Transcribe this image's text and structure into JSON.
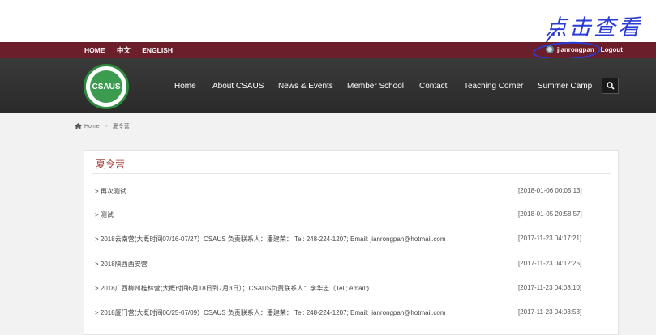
{
  "annotation": {
    "handwritten_note": "点击查看"
  },
  "topbar": {
    "links": [
      "HOME",
      "中文",
      "ENGLISH"
    ],
    "username": "jianrongpan",
    "logout": "Logout"
  },
  "logo_text": "CSAUS",
  "nav": {
    "items": [
      "Home",
      "About CSAUS",
      "News & Events",
      "Member School",
      "Contact",
      "Teaching Corner",
      "Summer Camp"
    ]
  },
  "breadcrumb": {
    "home": "Home",
    "current": "夏令营"
  },
  "card": {
    "title": "夏令营",
    "rows": [
      {
        "title": "> 再次测试",
        "date": "[2018-01-06 00:05:13]"
      },
      {
        "title": "> 测试",
        "date": "[2018-01-05 20:58:57]"
      },
      {
        "title": "> 2018云南营(大概时间07/16-07/27）CSAUS 负责联系人：潘建荣： Tel: 248-224-1207; Email: jianrongpan@hotmail.com",
        "date": "[2017-11-23 04:17:21]"
      },
      {
        "title": "> 2018陕西西安营",
        "date": "[2017-11-23 04:12:25]"
      },
      {
        "title": "> 2018广西柳州桂林营(大概时间6月18日到7月3日）；CSAUS负责联系人：李华志（Tel:; email:)",
        "date": "[2017-11-23 04:08:10]"
      },
      {
        "title": "> 2018厦门营(大概时间06/25-07/09）CSAUS 负责联系人：潘建荣： Tel: 248-224-1207; Email: jianrongpan@hotmail.com",
        "date": "[2017-11-23 04:03:53]"
      }
    ]
  }
}
